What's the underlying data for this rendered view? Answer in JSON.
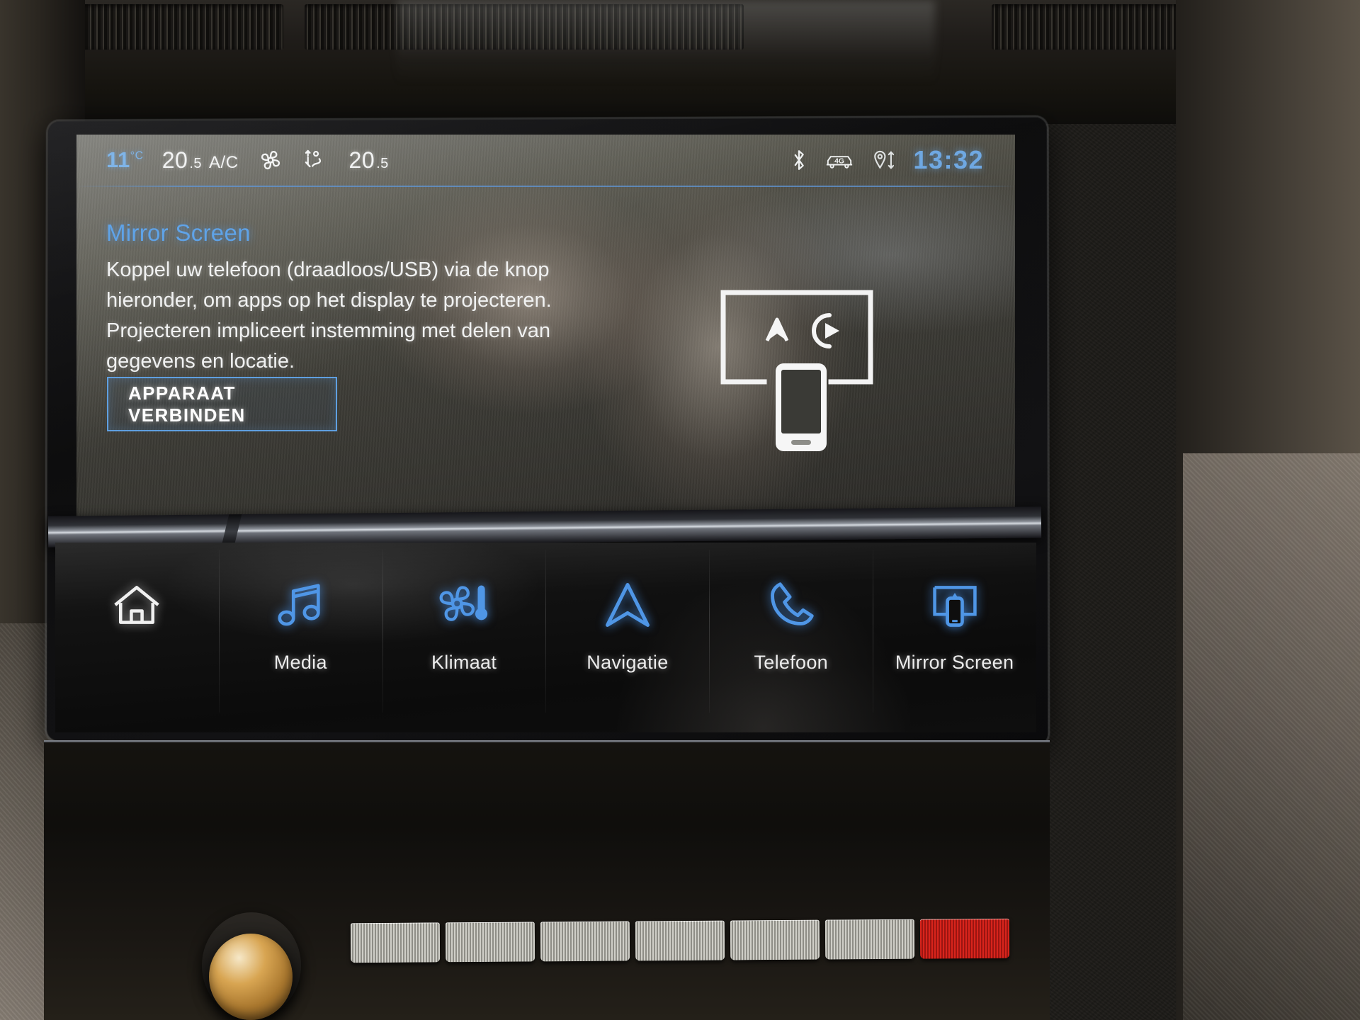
{
  "status_bar": {
    "outside_temp_value": "11",
    "outside_temp_unit": "°C",
    "driver_temp_int": "20",
    "driver_temp_dec": ".5",
    "ac_label": "A/C",
    "fan_icon": "fan-icon",
    "airflow_icon": "airflow-direction-icon",
    "passenger_temp_int": "20",
    "passenger_temp_dec": ".5",
    "bluetooth_icon": "bluetooth-icon",
    "network_icon": "car-4g-icon",
    "location_icon": "location-sharing-icon",
    "clock": "13:32"
  },
  "panel": {
    "title": "Mirror Screen",
    "body": "Koppel uw telefoon (draadloos/USB) via de knop hieronder, om apps op het display te projecteren. Projecteren impliceert instemming met delen van gegevens en locatie.",
    "connect_button": "APPARAAT VERBINDEN",
    "illustration": "screen-mirroring-illustration"
  },
  "nav_bar": {
    "items": [
      {
        "label": "",
        "icon": "home-icon",
        "color": "#f0f0f0"
      },
      {
        "label": "Media",
        "icon": "music-note-icon",
        "color": "#4f96e6"
      },
      {
        "label": "Klimaat",
        "icon": "fan-thermometer-icon",
        "color": "#4f96e6"
      },
      {
        "label": "Navigatie",
        "icon": "navigation-arrow-icon",
        "color": "#4f96e6"
      },
      {
        "label": "Telefoon",
        "icon": "phone-handset-icon",
        "color": "#4f96e6"
      },
      {
        "label": "Mirror Screen",
        "icon": "screen-mirror-icon",
        "color": "#4f96e6"
      }
    ]
  },
  "colors": {
    "accent_blue": "#5fa3e8",
    "clock_blue": "#6fa8e2",
    "text_white": "#f0f1f1",
    "screen_bg": "#3c3b35",
    "nav_bg": "#0e0e0e"
  }
}
